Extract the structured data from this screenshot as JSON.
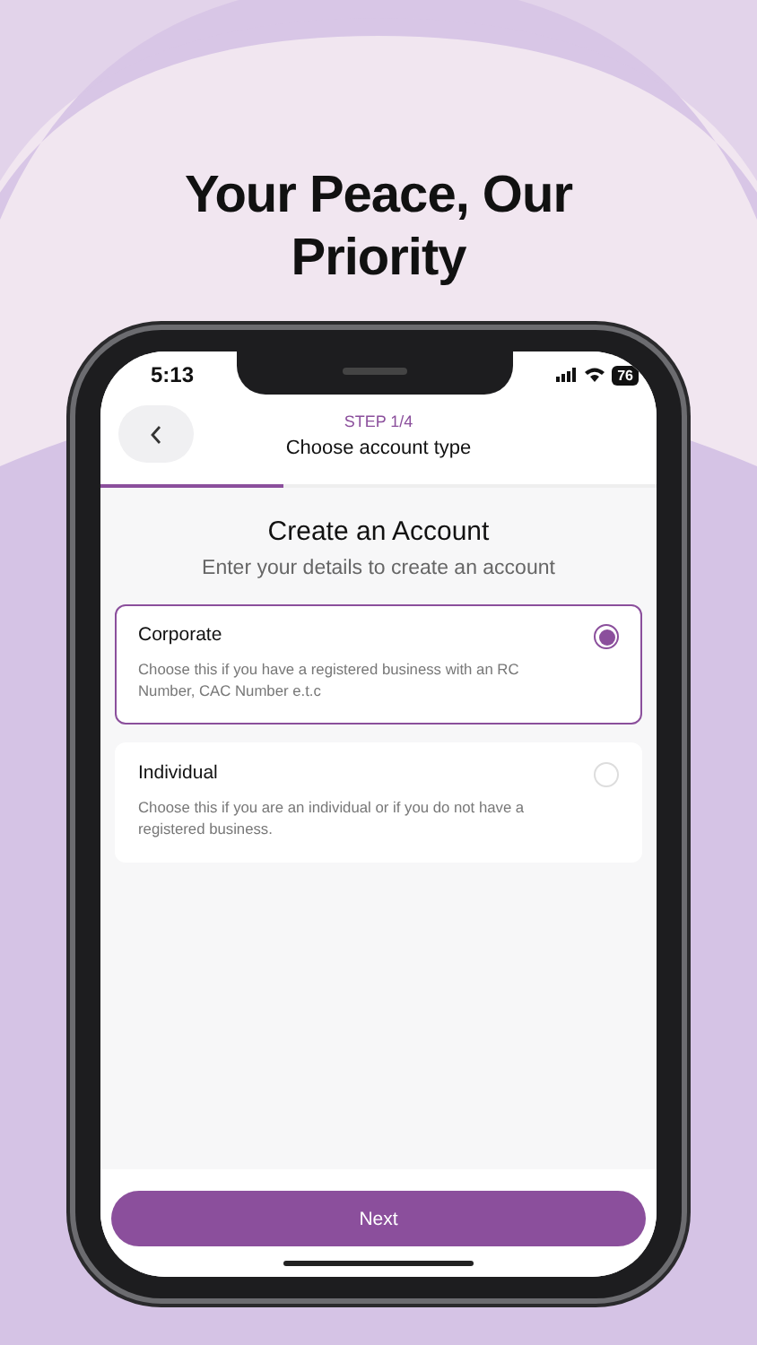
{
  "headline": "Your Peace, Our Priority",
  "status_bar": {
    "time": "5:13",
    "battery": "76"
  },
  "header": {
    "step": "STEP 1/4",
    "title": "Choose account type",
    "progress": {
      "level": 0.33
    }
  },
  "heading": "Create an Account",
  "subheading": "Enter your details to create an account",
  "options": [
    {
      "title": "Corporate",
      "description": "Choose this if you have a registered business  with an RC Number, CAC Number e.t.c",
      "selected": true
    },
    {
      "title": "Individual",
      "description": "Choose this if you are an individual or if you do not have a registered business.",
      "selected": false
    }
  ],
  "next_button": "Next"
}
